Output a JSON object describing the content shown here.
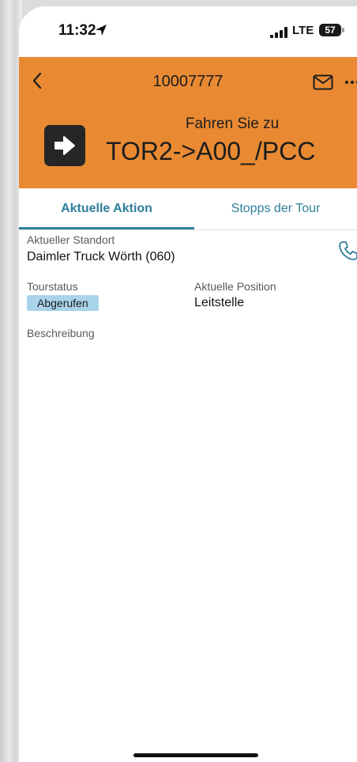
{
  "status_bar": {
    "time": "11:32",
    "network": "LTE",
    "battery": "57"
  },
  "header": {
    "tour_number": "10007777",
    "instruction": "Fahren Sie zu",
    "destination": "TOR2->A00_/PCC",
    "background_color": "#e98a33"
  },
  "tabs": [
    {
      "label": "Aktuelle Aktion",
      "active": true
    },
    {
      "label": "Stopps der Tour",
      "active": false
    }
  ],
  "details": {
    "location_label": "Aktueller Standort",
    "location_value": "Daimler Truck Wörth (060)",
    "tour_status_label": "Tourstatus",
    "tour_status_value": "Abgerufen",
    "position_label": "Aktuelle Position",
    "position_value": "Leitstelle",
    "description_label": "Beschreibung"
  },
  "icons": {
    "back": "chevron-left-icon",
    "mail": "mail-icon",
    "more": "more-icon",
    "direction": "arrow-right-icon",
    "phone": "phone-icon",
    "location": "location-arrow-icon",
    "signal": "signal-icon"
  },
  "colors": {
    "accent": "#2f7f9c",
    "header": "#e98a33",
    "badge": "#a9d3ea"
  }
}
